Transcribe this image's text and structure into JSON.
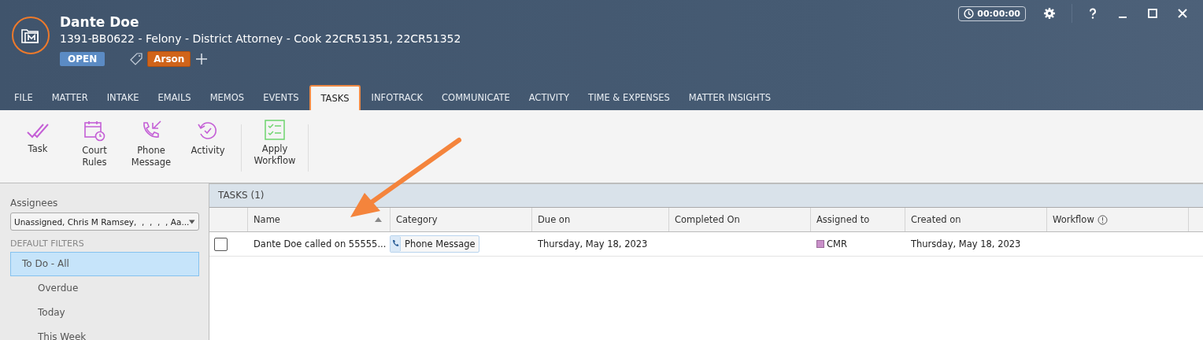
{
  "header": {
    "client_name": "Dante Doe",
    "matter_line": "1391-BB0622 - Felony - District Attorney - Cook 22CR51351, 22CR51352",
    "status": "OPEN",
    "tags": [
      {
        "label": "Arson",
        "color": "#d0641a"
      }
    ],
    "timer": "00:00:00"
  },
  "tabs": [
    {
      "label": "FILE",
      "selected": false
    },
    {
      "label": "MATTER",
      "selected": false
    },
    {
      "label": "INTAKE",
      "selected": false
    },
    {
      "label": "EMAILS",
      "selected": false
    },
    {
      "label": "MEMOS",
      "selected": false
    },
    {
      "label": "EVENTS",
      "selected": false
    },
    {
      "label": "TASKS",
      "selected": true
    },
    {
      "label": "INFOTRACK",
      "selected": false
    },
    {
      "label": "COMMUNICATE",
      "selected": false
    },
    {
      "label": "ACTIVITY",
      "selected": false
    },
    {
      "label": "TIME & EXPENSES",
      "selected": false
    },
    {
      "label": "MATTER INSIGHTS",
      "selected": false
    }
  ],
  "toolbar": [
    {
      "kind": "task",
      "label": "Task"
    },
    {
      "kind": "court",
      "label": "Court Rules"
    },
    {
      "kind": "phone",
      "label": "Phone Message"
    },
    {
      "kind": "activity",
      "label": "Activity"
    },
    {
      "kind": "workflow",
      "label": "Apply Workflow"
    }
  ],
  "sidebar": {
    "assignees_label": "Assignees",
    "assignees_value": "Unassigned, Chris M Ramsey,  ,  ,  ,  , Aa...",
    "filters_heading": "DEFAULT FILTERS",
    "filters": [
      {
        "label": "To Do - All",
        "selected": true,
        "children": [
          {
            "label": "Overdue",
            "selected": false
          },
          {
            "label": "Today",
            "selected": false
          },
          {
            "label": "This Week",
            "selected": false
          }
        ]
      }
    ]
  },
  "table": {
    "title": "TASKS (1)",
    "columns": [
      {
        "label": "Name",
        "sorted": true,
        "info": false
      },
      {
        "label": "Category",
        "sorted": false,
        "info": false
      },
      {
        "label": "Due on",
        "sorted": false,
        "info": false
      },
      {
        "label": "Completed On",
        "sorted": false,
        "info": false
      },
      {
        "label": "Assigned to",
        "sorted": false,
        "info": false
      },
      {
        "label": "Created on",
        "sorted": false,
        "info": false
      },
      {
        "label": "Workflow",
        "sorted": false,
        "info": true
      }
    ],
    "rows": [
      {
        "checked": false,
        "name": "Dante Doe called on 55555...",
        "category": "Phone Message",
        "due_on": "Thursday, May 18, 2023",
        "assigned_to": "CMR",
        "color": "#c990c9",
        "created_on": "Thursday, May 18, 2023"
      }
    ]
  }
}
